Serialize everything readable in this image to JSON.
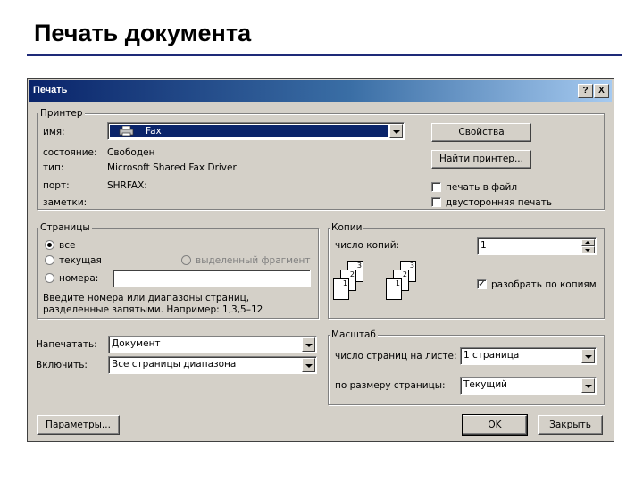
{
  "slide": {
    "title": "Печать документа"
  },
  "dialog": {
    "title": "Печать",
    "help_btn": "?",
    "close_btn": "X",
    "printer": {
      "legend": "Принтер",
      "name_label": "имя:",
      "name_value": "Fax",
      "status_label": "состояние:",
      "status_value": "Свободен",
      "type_label": "тип:",
      "type_value": "Microsoft Shared Fax Driver",
      "port_label": "порт:",
      "port_value": "SHRFAX:",
      "notes_label": "заметки:",
      "properties_btn": "Свойства",
      "find_printer_btn": "Найти принтер...",
      "print_to_file": "печать в файл",
      "duplex": "двусторонняя печать",
      "print_to_file_checked": false,
      "duplex_checked": false
    },
    "pages": {
      "legend": "Страницы",
      "all": "все",
      "current": "текущая",
      "selection": "выделенный фрагмент",
      "numbers": "номера:",
      "numbers_value": "",
      "hint": "Введите номера или диапазоны страниц, разделенные запятыми. Например: 1,3,5–12",
      "selected": "all"
    },
    "copies": {
      "legend": "Копии",
      "count_label": "число копий:",
      "count_value": "1",
      "collate": "разобрать по копиям",
      "collate_checked": true,
      "stack_labels": [
        "3",
        "2",
        "1"
      ]
    },
    "print_what_label": "Напечатать:",
    "print_what_value": "Документ",
    "include_label": "Включить:",
    "include_value": "Все страницы диапазона",
    "zoom": {
      "legend": "Масштаб",
      "pages_per_sheet_label": "число страниц на листе:",
      "pages_per_sheet_value": "1 страница",
      "scale_label": "по размеру страницы:",
      "scale_value": "Текущий"
    },
    "options_btn": "Параметры...",
    "ok_btn": "OK",
    "close_label": "Закрыть"
  }
}
